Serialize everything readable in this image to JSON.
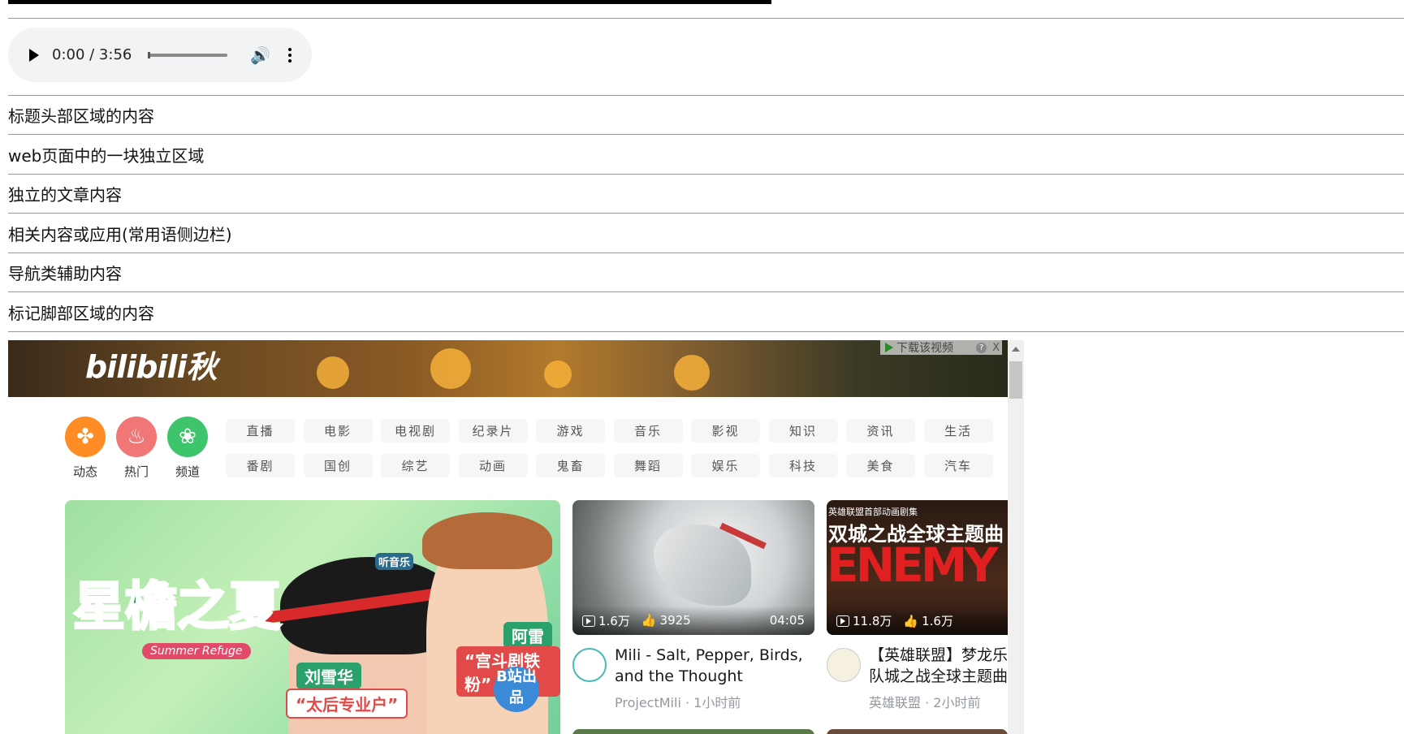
{
  "audio": {
    "time": "0:00 / 3:56"
  },
  "lines": [
    "标题头部区域的内容",
    "web页面中的一块独立区域",
    "独立的文章内容",
    "相关内容或应用(常用语侧边栏)",
    "导航类辅助内容",
    "标记脚部区域的内容"
  ],
  "frame": {
    "banner_logo": "bilibili秋",
    "download_bar": "下载该视频",
    "download_close": "X",
    "channels": [
      {
        "label": "动态",
        "icon": "pinwheel-icon",
        "color": "#ff8c24"
      },
      {
        "label": "热门",
        "icon": "fire-icon",
        "color": "#f07775"
      },
      {
        "label": "频道",
        "icon": "channels-icon",
        "color": "#3ec46a"
      }
    ],
    "tags_row1": [
      "直播",
      "电影",
      "电视剧",
      "纪录片",
      "游戏",
      "音乐",
      "影视",
      "知识",
      "资讯",
      "生活"
    ],
    "tags_row2": [
      "番剧",
      "国创",
      "综艺",
      "动画",
      "鬼畜",
      "舞蹈",
      "娱乐",
      "科技",
      "美食",
      "汽车"
    ],
    "big_card": {
      "title": "星檐之夏",
      "subtitle": "Summer Refuge",
      "name1": "刘雪华",
      "role1": "“太后专业户”",
      "name2": "阿雷",
      "role2": "“宫斗剧铁粉”",
      "tag": "听音乐",
      "bzhan": "B站出品"
    },
    "cards": [
      {
        "plays": "1.6万",
        "likes": "3925",
        "duration": "04:05",
        "title": "Mili - Salt, Pepper, Birds, and the Thought Police...",
        "uploader": "ProjectMili",
        "time": "1小时前"
      },
      {
        "plays": "11.8万",
        "likes": "1.6万",
        "duration": "",
        "caption": "英雄联盟首部动画剧集",
        "heading": "双城之战全球主题曲",
        "thumb_text": "ENEMY",
        "title": "【英雄联盟】梦龙乐队城之战全球主题曲《",
        "uploader": "英雄联盟",
        "time": "2小时前"
      }
    ]
  }
}
